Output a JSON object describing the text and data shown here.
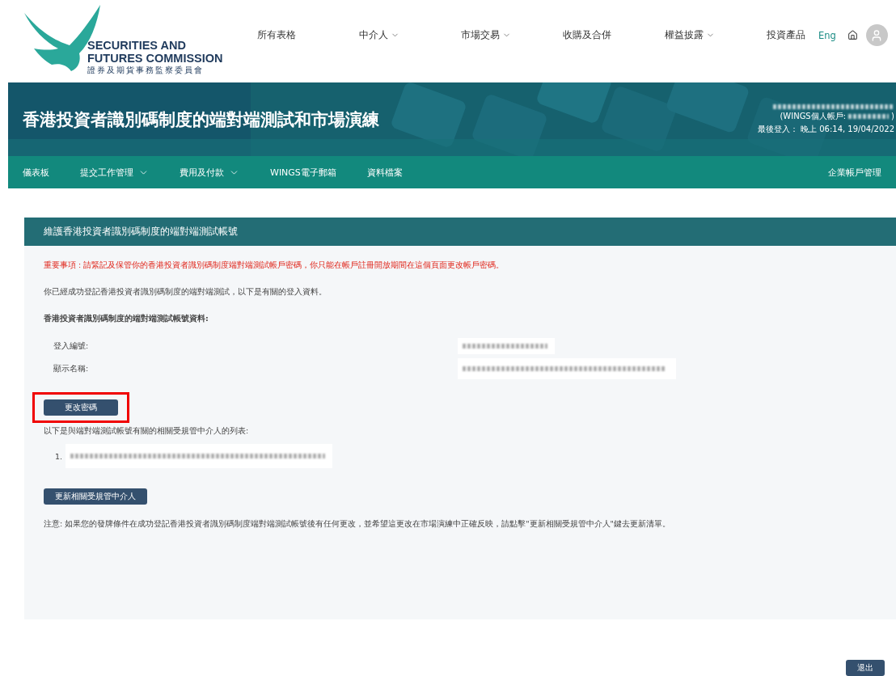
{
  "header": {
    "logo": {
      "lines": [
        "SECURITIES AND",
        "FUTURES COMMISSION"
      ],
      "chinese": "證券及期貨事務監察委員會"
    },
    "menu": [
      {
        "label": "所有表格",
        "dropdown": false
      },
      {
        "label": "中介人",
        "dropdown": true
      },
      {
        "label": "市場交易",
        "dropdown": true
      },
      {
        "label": "收購及合併",
        "dropdown": false
      },
      {
        "label": "權益披露",
        "dropdown": true
      },
      {
        "label": "投資產品",
        "dropdown": false
      }
    ],
    "language": "Eng"
  },
  "banner": {
    "title": "香港投資者識別碼制度的端對端測試和市場演練",
    "account_prefix": "(WINGS個人帳戶:",
    "account_suffix": ")",
    "last_login": "最後登入： 晚上 06:14, 19/04/2022"
  },
  "nav": {
    "items": [
      {
        "label": "儀表板",
        "dropdown": false
      },
      {
        "label": "提交工作管理",
        "dropdown": true
      },
      {
        "label": "費用及付款",
        "dropdown": true
      },
      {
        "label": "WINGS電子郵箱",
        "dropdown": false
      },
      {
        "label": "資料檔案",
        "dropdown": false
      }
    ],
    "right": "企業帳戶管理"
  },
  "panel": {
    "title": "維護香港投資者識別碼制度的端對端測試帳號",
    "warning": "重要事項 : 請緊記及保管你的香港投資者識別碼制度端對端測試帳戶密碼，你只能在帳戶註冊開放期間在這個頁面更改帳戶密碼。",
    "intro": "你已經成功登記香港投資者識別碼制度的端對端測試，以下是有關的登入資料。",
    "section_title": "香港投資者識別碼制度的端對端測試帳號資料:",
    "fields": [
      {
        "label": "登入編號:"
      },
      {
        "label": "顯示名稱:"
      }
    ],
    "change_password": {
      "label": "更改密碼",
      "highlighted": true
    },
    "list_title": "以下是與端對端測試帳號有關的相關受規管中介人的列表:",
    "list": [
      {
        "number": "1."
      }
    ],
    "update_button": "更新相關受規管中介人",
    "note": "注意: 如果您的發牌條件在成功登記香港投資者識別碼制度端對端測試帳號後有任何更改，並希望這更改在市場演練中正確反映，請點擊\"更新相關受規管中介人\"鍵去更新清單。"
  },
  "logout": "退出"
}
